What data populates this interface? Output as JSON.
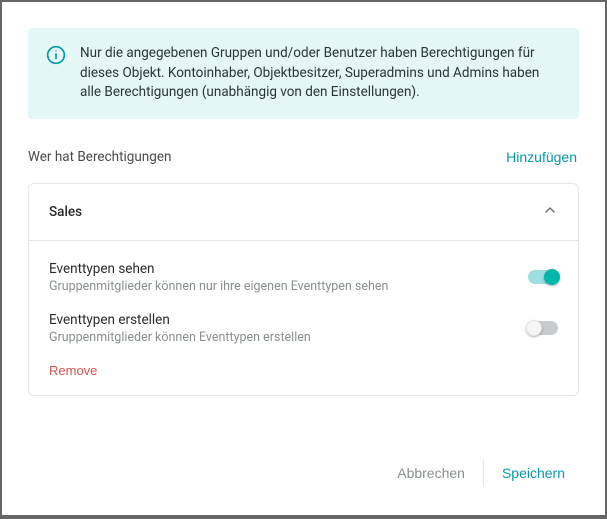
{
  "info": {
    "text": "Nur die angegebenen Gruppen und/oder Benutzer haben Berechtigungen für dieses Objekt. Kontoinhaber, Objektbesitzer, Superadmins und Admins haben alle Berechtigungen (unabhängig von den Einstellungen)."
  },
  "section": {
    "title": "Wer hat Berechtigungen",
    "add_label": "Hinzufügen"
  },
  "group": {
    "name": "Sales",
    "permissions": [
      {
        "label": "Eventtypen sehen",
        "desc": "Gruppenmitglieder können nur ihre eigenen Eventtypen sehen",
        "enabled": true
      },
      {
        "label": "Eventtypen erstellen",
        "desc": "Gruppenmitglieder können Eventtypen erstellen",
        "enabled": false
      }
    ],
    "remove_label": "Remove"
  },
  "footer": {
    "cancel": "Abbrechen",
    "save": "Speichern"
  }
}
